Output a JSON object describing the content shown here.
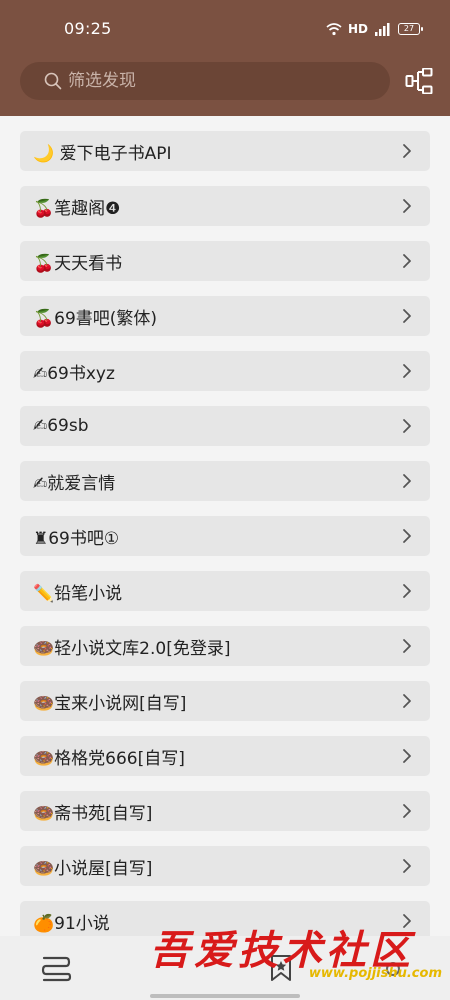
{
  "status_bar": {
    "time": "09:25",
    "network": "HD",
    "battery": "27"
  },
  "search": {
    "placeholder": "筛选发现",
    "value": ""
  },
  "items": [
    {
      "label": "🌙 爱下电子书API"
    },
    {
      "label": "🍒笔趣阁❹"
    },
    {
      "label": "🍒天天看书"
    },
    {
      "label": "🍒69書吧(繁体)"
    },
    {
      "label": "✍69书xyz"
    },
    {
      "label": "✍69sb"
    },
    {
      "label": "✍就爱言情"
    },
    {
      "label": "♜69书吧①"
    },
    {
      "label": "✏️铅笔小说"
    },
    {
      "label": "🍩轻小说文库2.0[免登录]"
    },
    {
      "label": "🍩宝来小说网[自写]"
    },
    {
      "label": "🍩格格党666[自写]"
    },
    {
      "label": "🍩斋书苑[自写]"
    },
    {
      "label": "🍩小说屋[自写]"
    },
    {
      "label": "🍊91小说"
    }
  ],
  "watermark": {
    "text": "吾爱技术社区",
    "url": "www.pojjishu.com"
  },
  "colors": {
    "header": "#7b5141",
    "search_bg": "#6b4536",
    "item_bg": "#e6e6e6",
    "page_bg": "#f4f4f4"
  },
  "icons": [
    "search-icon",
    "group-icon",
    "chevron-right-icon",
    "bookshelf-icon",
    "bookmark-icon",
    "wifi-icon",
    "signal-icon",
    "battery-icon"
  ]
}
